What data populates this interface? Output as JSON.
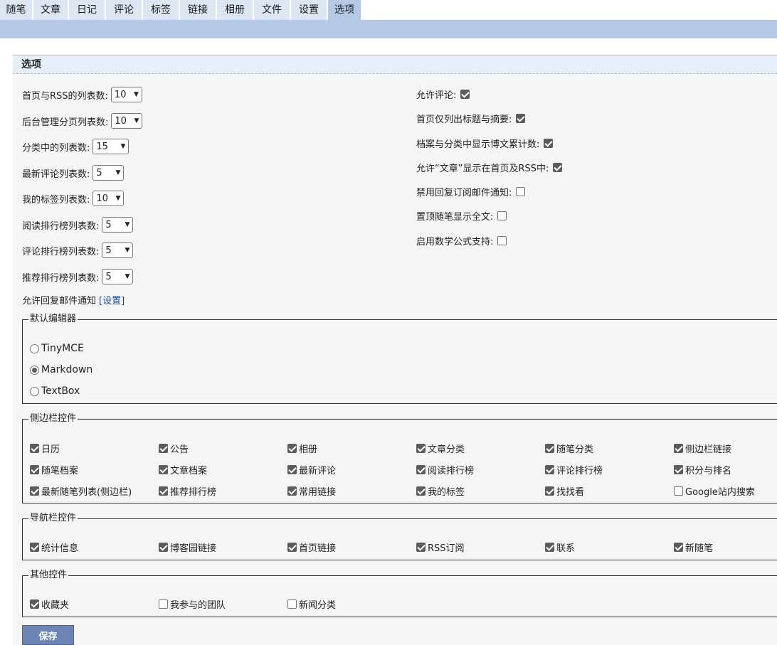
{
  "nav": {
    "tabs": [
      {
        "label": "随笔"
      },
      {
        "label": "文章"
      },
      {
        "label": "日记"
      },
      {
        "label": "评论"
      },
      {
        "label": "标签"
      },
      {
        "label": "链接"
      },
      {
        "label": "相册"
      },
      {
        "label": "文件"
      },
      {
        "label": "设置"
      },
      {
        "label": "选项"
      }
    ],
    "active": "选项"
  },
  "panel": {
    "title": "选项"
  },
  "list_settings": [
    {
      "label": "首页与RSS的列表数:",
      "value": "10"
    },
    {
      "label": "后台管理分页列表数:",
      "value": "10"
    },
    {
      "label": "分类中的列表数:",
      "value": "15"
    },
    {
      "label": "最新评论列表数:",
      "value": "5"
    },
    {
      "label": "我的标签列表数:",
      "value": "10"
    },
    {
      "label": "阅读排行榜列表数:",
      "value": "5"
    },
    {
      "label": "评论排行榜列表数:",
      "value": "5"
    },
    {
      "label": "推荐排行榜列表数:",
      "value": "5"
    }
  ],
  "reply_mail": {
    "label": "允许回复邮件通知",
    "link": "[设置]"
  },
  "right_options": [
    {
      "label": "允许评论:",
      "checked": true
    },
    {
      "label": "首页仅列出标题与摘要:",
      "checked": true
    },
    {
      "label": "档案与分类中显示博文累计数:",
      "checked": true
    },
    {
      "label": "允许“文章”显示在首页及RSS中:",
      "checked": true
    },
    {
      "label": "禁用回复订阅邮件通知:",
      "checked": false
    },
    {
      "label": "置顶随笔显示全文:",
      "checked": false
    },
    {
      "label": "启用数学公式支持:",
      "checked": false
    }
  ],
  "editor": {
    "legend": "默认编辑器",
    "options": [
      {
        "label": "TinyMCE",
        "selected": false
      },
      {
        "label": "Markdown",
        "selected": true
      },
      {
        "label": "TextBox",
        "selected": false
      }
    ]
  },
  "sidebar_controls": {
    "legend": "侧边栏控件",
    "items": [
      {
        "label": "日历",
        "checked": true
      },
      {
        "label": "公告",
        "checked": true
      },
      {
        "label": "相册",
        "checked": true
      },
      {
        "label": "文章分类",
        "checked": true
      },
      {
        "label": "随笔分类",
        "checked": true
      },
      {
        "label": "侧边栏链接",
        "checked": true
      },
      {
        "label": "随笔档案",
        "checked": true
      },
      {
        "label": "文章档案",
        "checked": true
      },
      {
        "label": "最新评论",
        "checked": true
      },
      {
        "label": "阅读排行榜",
        "checked": true
      },
      {
        "label": "评论排行榜",
        "checked": true
      },
      {
        "label": "积分与排名",
        "checked": true
      },
      {
        "label": "最新随笔列表(侧边栏)",
        "checked": true
      },
      {
        "label": "推荐排行榜",
        "checked": true
      },
      {
        "label": "常用链接",
        "checked": true
      },
      {
        "label": "我的标签",
        "checked": true
      },
      {
        "label": "找找看",
        "checked": true
      },
      {
        "label": "Google站内搜索",
        "checked": false
      }
    ]
  },
  "navbar_controls": {
    "legend": "导航栏控件",
    "items": [
      {
        "label": "统计信息",
        "checked": true
      },
      {
        "label": "博客园链接",
        "checked": true
      },
      {
        "label": "首页链接",
        "checked": true
      },
      {
        "label": "RSS订阅",
        "checked": true
      },
      {
        "label": "联系",
        "checked": true
      },
      {
        "label": "新随笔",
        "checked": true
      }
    ]
  },
  "other_controls": {
    "legend": "其他控件",
    "items": [
      {
        "label": "收藏夹",
        "checked": true
      },
      {
        "label": "我参与的团队",
        "checked": false
      },
      {
        "label": "新闻分类",
        "checked": false
      }
    ]
  },
  "save_label": "保存"
}
